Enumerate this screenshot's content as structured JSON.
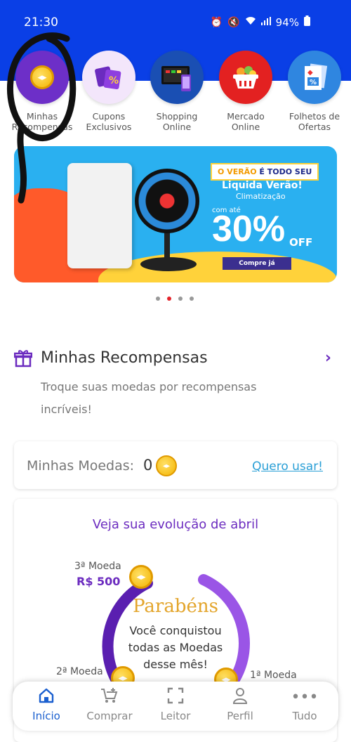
{
  "status": {
    "time": "21:30",
    "battery": "94%"
  },
  "shortcuts": [
    {
      "label": "Minhas Recompensas",
      "icon": "coin-icon",
      "color": "#6d2fc8"
    },
    {
      "label": "Cupons Exclusivos",
      "icon": "coupon-icon",
      "color": "#f3e6fb"
    },
    {
      "label": "Shopping Online",
      "icon": "devices-icon",
      "color": "#1a4fb3"
    },
    {
      "label": "Mercado Online",
      "icon": "basket-icon",
      "color": "#e32121"
    },
    {
      "label": "Folhetos de Ofertas",
      "icon": "leaflet-icon",
      "color": "#2f86e0"
    }
  ],
  "banner": {
    "tag_a": "O VERÃO",
    "tag_b": "É TODO SEU",
    "title": "Liquida Verão!",
    "subtitle": "Climatização",
    "upto": "com até",
    "percent": "30%",
    "off": "OFF",
    "cta": "Compre já"
  },
  "carousel": {
    "total": 4,
    "active_index": 1
  },
  "rewards": {
    "title": "Minhas Recompensas",
    "description": "Troque suas moedas por recompensas incríveis!"
  },
  "coins": {
    "label": "Minhas Moedas:",
    "value": "0",
    "link": "Quero usar!"
  },
  "evolution": {
    "title": "Veja sua evolução de abril",
    "coin3_label": "3ª Moeda",
    "coin3_value": "R$ 500",
    "coin2_label": "2ª Moeda",
    "coin1_label": "1ª Moeda",
    "congrats": "Parabéns",
    "message": "Você conquistou todas as Moedas desse mês!"
  },
  "nav": [
    {
      "label": "Início",
      "icon": "home-icon",
      "active": true
    },
    {
      "label": "Comprar",
      "icon": "cart-plus-icon",
      "active": false
    },
    {
      "label": "Leitor",
      "icon": "scanner-icon",
      "active": false
    },
    {
      "label": "Perfil",
      "icon": "person-icon",
      "active": false
    },
    {
      "label": "Tudo",
      "icon": "more-icon",
      "active": false
    }
  ],
  "colors": {
    "header_blue": "#0a3fe6",
    "purple": "#6b2bbf",
    "link": "#2a9fd6",
    "active_nav": "#1a5fcf"
  }
}
